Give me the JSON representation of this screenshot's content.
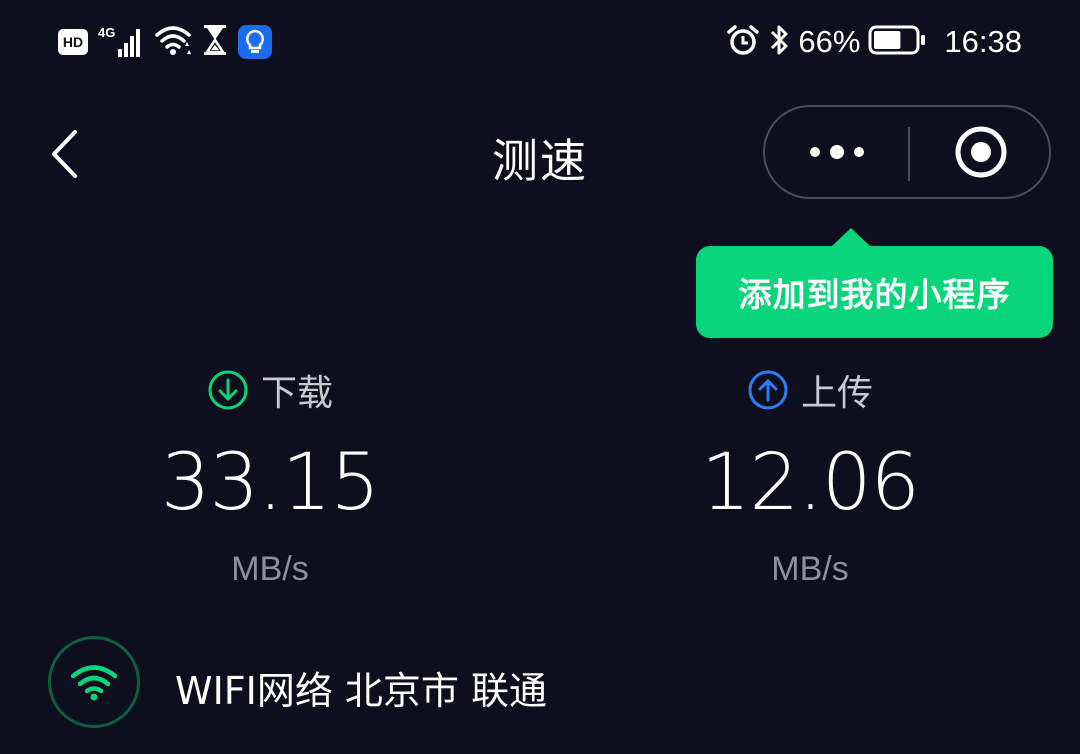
{
  "status_bar": {
    "hd_label": "HD",
    "network_label": "4G",
    "battery_percent": "66%",
    "time": "16:38",
    "icons_left": [
      "hd-icon",
      "signal-icon",
      "wifi-icon",
      "hourglass-icon",
      "lightbulb-icon"
    ],
    "icons_right": [
      "alarm-icon",
      "bluetooth-icon",
      "battery-icon"
    ],
    "battery_level": 0.66
  },
  "nav": {
    "title": "测速",
    "back_icon": "chevron-left-icon",
    "more_icon": "more-dots-icon",
    "close_icon": "target-close-icon"
  },
  "tooltip": {
    "text": "添加到我的小程序"
  },
  "download": {
    "label": "下载",
    "value": "33.15",
    "unit": "MB/s",
    "icon": "arrow-down-circle-icon"
  },
  "upload": {
    "label": "上传",
    "value": "12.06",
    "unit": "MB/s",
    "icon": "arrow-up-circle-icon"
  },
  "network": {
    "text": "WIFI网络 北京市 联通",
    "icon": "wifi-icon"
  },
  "colors": {
    "background": "#0e0f1e",
    "accent_green": "#09d57a",
    "upload_blue": "#2c7df6",
    "capsule_border": "#4a4d5a"
  }
}
